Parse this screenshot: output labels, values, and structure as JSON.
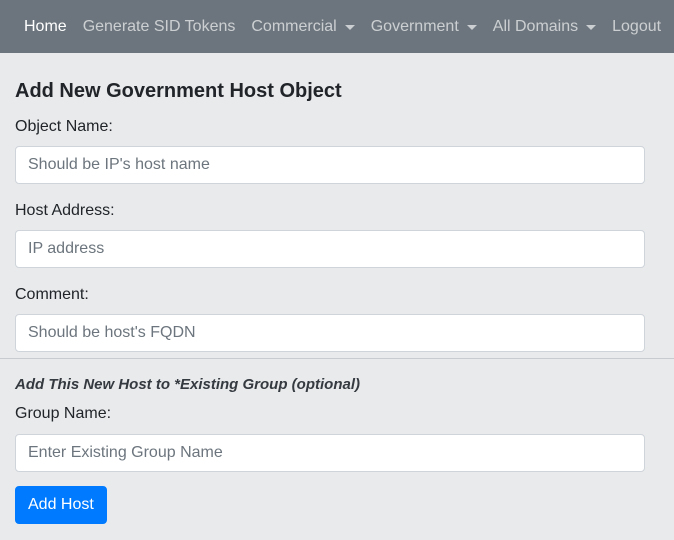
{
  "navbar": {
    "items": [
      {
        "label": "Home",
        "active": true,
        "dropdown": false
      },
      {
        "label": "Generate SID Tokens",
        "active": false,
        "dropdown": false
      },
      {
        "label": "Commercial",
        "active": false,
        "dropdown": true
      },
      {
        "label": "Government",
        "active": false,
        "dropdown": true
      },
      {
        "label": "All Domains",
        "active": false,
        "dropdown": true
      },
      {
        "label": "Logout",
        "active": false,
        "dropdown": false
      }
    ]
  },
  "form": {
    "title": "Add New Government Host Object",
    "object_name": {
      "label": "Object Name:",
      "placeholder": "Should be IP's host name",
      "value": ""
    },
    "host_address": {
      "label": "Host Address:",
      "placeholder": "IP address",
      "value": ""
    },
    "comment": {
      "label": "Comment:",
      "placeholder": "Should be host's FQDN",
      "value": ""
    },
    "group_section_title": "Add This New Host to *Existing Group (optional)",
    "group_name": {
      "label": "Group Name:",
      "placeholder": "Enter Existing Group Name",
      "value": ""
    },
    "submit_label": "Add Host"
  },
  "colors": {
    "navbar_bg": "#6c757d",
    "page_bg": "#e9eaec",
    "primary": "#007bff"
  }
}
